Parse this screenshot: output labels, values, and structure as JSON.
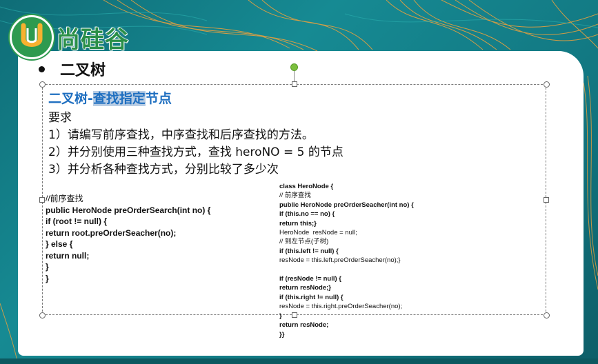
{
  "logo": {
    "mark": "U",
    "text": "尚硅谷"
  },
  "slide": {
    "bullet_title": "二叉树",
    "subtitle_prefix": "二叉树-",
    "subtitle_highlight": "查找指定",
    "subtitle_suffix": "节点",
    "requirements_heading": "要求",
    "requirements": [
      "1）请编写前序查找，中序查找和后序查找的方法。",
      "2）并分别使用三种查找方式，查找 heroNO = 5 的节点",
      "3）并分析各种查找方式，分别比较了多少次"
    ]
  },
  "code_left": [
    "//前序查找",
    "public HeroNode preOrderSearch(int no) {",
    "if (root != null) {",
    "return root.preOrderSeacher(no);",
    "} else {",
    "return null;",
    "}",
    "}"
  ],
  "code_right": [
    "class HeroNode {",
    "// 前序查找",
    "public HeroNode preOrderSeacher(int no) {",
    "if (this.no == no) {",
    "return this;}",
    "HeroNode  resNode = null;",
    "// 到左节点(子树)",
    "if (this.left != null) {",
    "resNode = this.left.preOrderSeacher(no);}",
    "",
    "if (resNode != null) {",
    "return resNode;}",
    "if (this.right != null) {",
    "resNode = this.right.preOrderSeacher(no);",
    "}",
    "return resNode;",
    "}}"
  ],
  "colors": {
    "background_teal": "#168a93",
    "wave_orange": "#f2a23a",
    "logo_green": "#2e9a4f",
    "subtitle_blue": "#1f6fc0",
    "selection_highlight": "#b9cde4",
    "rotation_handle_green": "#7bbf3d"
  }
}
